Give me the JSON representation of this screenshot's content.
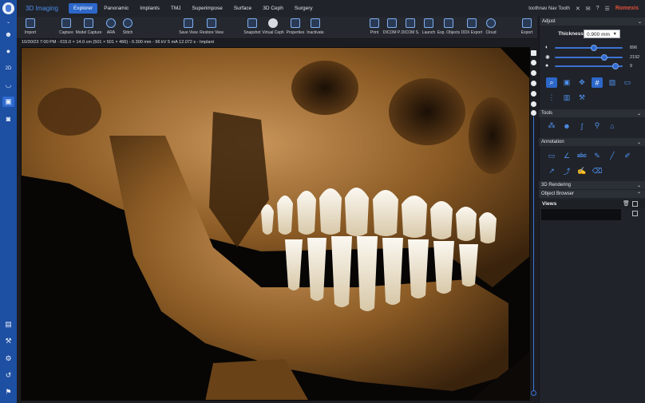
{
  "app": {
    "title": "3D Imaging",
    "brand": "Romexis",
    "user": "toothnav Nav Tooth"
  },
  "nav": {
    "tabs": [
      "Explorer",
      "Panoramic",
      "Implants",
      "TMJ",
      "Superimpose",
      "Surface",
      "3D Ceph",
      "Surgery"
    ],
    "active": "Explorer"
  },
  "toolbar": {
    "import": "Import",
    "capture": "Capture",
    "model_capture": "Model Capture",
    "ara": "ARA",
    "stitch": "Stitch",
    "save_view": "Save View",
    "restore_view": "Restore View",
    "snapshot": "Snapshot",
    "virtual_ceph": "Virtual Ceph",
    "properties": "Properties",
    "inactivate": "Inactivate",
    "print": "Print",
    "dicom_p": "DICOM P.",
    "dicom_s": "DICOM S.",
    "launch": "Launch",
    "exp_objects": "Exp. Objects",
    "ddx_export": "DDX Export",
    "cloud": "Cloud",
    "export": "Export"
  },
  "viewport": {
    "info": "10/30/23 7:00 PM - 015.0 × 14.0 cm (501 × 501 × 466) - 0.300 mm - 96 kV 5 mA 12.072 s - Implant",
    "render_colors": {
      "background": "#070605",
      "bone": "#8a5a24",
      "bone_light": "#c9955a",
      "teeth": "#f2eee6"
    }
  },
  "panel": {
    "adjust": "Adjust",
    "thickness_label": "Thickness",
    "thickness_value": "0.900 mm",
    "sliders": [
      {
        "icon": "contrast-icon",
        "value": "896",
        "level": 0.62
      },
      {
        "icon": "brightness-icon",
        "value": "2192",
        "level": 0.76
      },
      {
        "icon": "opacity-icon",
        "value": "9",
        "level": 0.92
      }
    ],
    "tools": "Tools",
    "annotation": "Annotation",
    "rendering_3d": "3D Rendering",
    "object_browser": "Object Browser",
    "views": "Views"
  },
  "colors": {
    "accent": "#2c67c9",
    "brand_red": "#e0503a",
    "rail": "#1d4fa3",
    "icon_blue": "#4f93f2"
  }
}
